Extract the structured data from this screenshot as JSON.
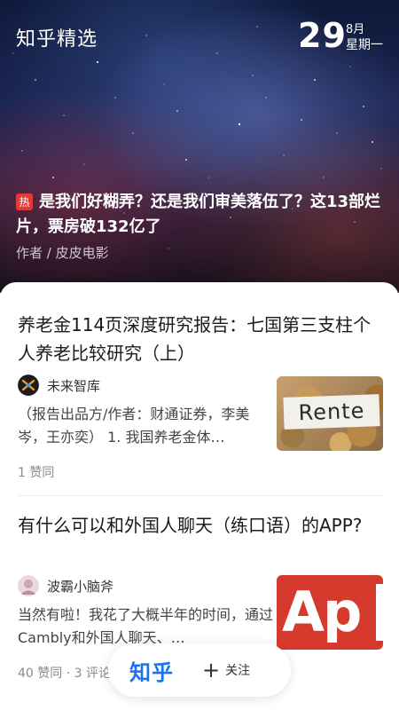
{
  "header": {
    "brand": "知乎精选",
    "date_day": "29",
    "date_month": "8月",
    "date_weekday": "星期一"
  },
  "hero": {
    "badge": "热",
    "title": "是我们好糊弄？还是我们审美落伍了？这13部烂片，票房破132亿了",
    "author": "作者 / 皮皮电影"
  },
  "feed": [
    {
      "title": "养老金114页深度研究报告：七国第三支柱个人养老比较研究（上）",
      "source": "未来智库",
      "excerpt": "（报告出品方/作者：财通证券，李美岑，王亦奕） 1. 我国养老金体…",
      "meta": "1 赞同",
      "thumb_text": "Rente"
    },
    {
      "title": "有什么可以和外国人聊天（练口语）的APP?",
      "source": "波霸小脑斧",
      "excerpt": "当然有啦！我花了大概半年的时间，通过Cambly和外国人聊天、…",
      "meta": "40 赞同 · 3 评论",
      "thumb_text": "Ap"
    }
  ],
  "floating_bar": {
    "logo": "知乎",
    "follow": "关注",
    "follow_icon": "plus-icon"
  },
  "colors": {
    "accent": "#1772f6",
    "hot_badge": "#e5383b"
  }
}
